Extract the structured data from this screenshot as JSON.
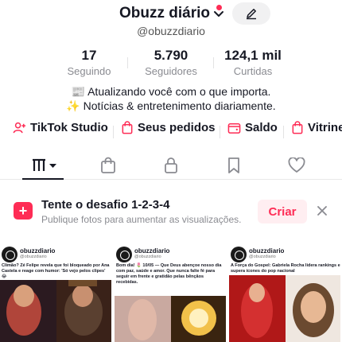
{
  "profile": {
    "name": "Obuzz diário",
    "handle": "@obuzzdiario"
  },
  "stats": [
    {
      "value": "17",
      "label": "Seguindo"
    },
    {
      "value": "5.790",
      "label": "Seguidores"
    },
    {
      "value": "124,1 mil",
      "label": "Curtidas"
    }
  ],
  "bio": {
    "line1": "📰 Atualizando você com o que importa.",
    "line2": "✨ Notícias & entretenimento diariamente."
  },
  "links": [
    {
      "label": "TikTok Studio",
      "icon": "person-add-icon"
    },
    {
      "label": "Seus pedidos",
      "icon": "bag-icon"
    },
    {
      "label": "Saldo",
      "icon": "wallet-icon"
    },
    {
      "label": "Vitrine",
      "icon": "shop-icon"
    }
  ],
  "tabs": [
    "videos-grid",
    "shop-bag",
    "private-lock",
    "bookmark",
    "liked-heart"
  ],
  "banner": {
    "title": "Tente o desafio 1-2-3-4",
    "subtitle": "Publique fotos para aumentar as visualizações.",
    "cta": "Criar"
  },
  "posts": [
    {
      "author": "obuzzdiario",
      "handle": "@obuzzdiario",
      "text": "Climão? Zé Felipe revela que foi bloqueado por Ana Castela e reage com humor: 'Só vejo pelos clipes' 😂"
    },
    {
      "author": "obuzzdiario",
      "handle": "@obuzzdiario",
      "text": "Bom dia! 🌷 10/05 — Que Deus abençoe nosso dia com paz, saúde e amor. Que nunca falte fé para seguir em frente e gratidão pelas bênçãos recebidas."
    },
    {
      "author": "obuzzdiario",
      "handle": "@obuzzdiario",
      "text": "A Força do Gospel: Gabriela Rocha lidera rankings e supera ícones do pop nacional"
    }
  ],
  "colors": {
    "accent": "#fe2c55",
    "text": "#161823",
    "muted": "#8a8b91"
  }
}
